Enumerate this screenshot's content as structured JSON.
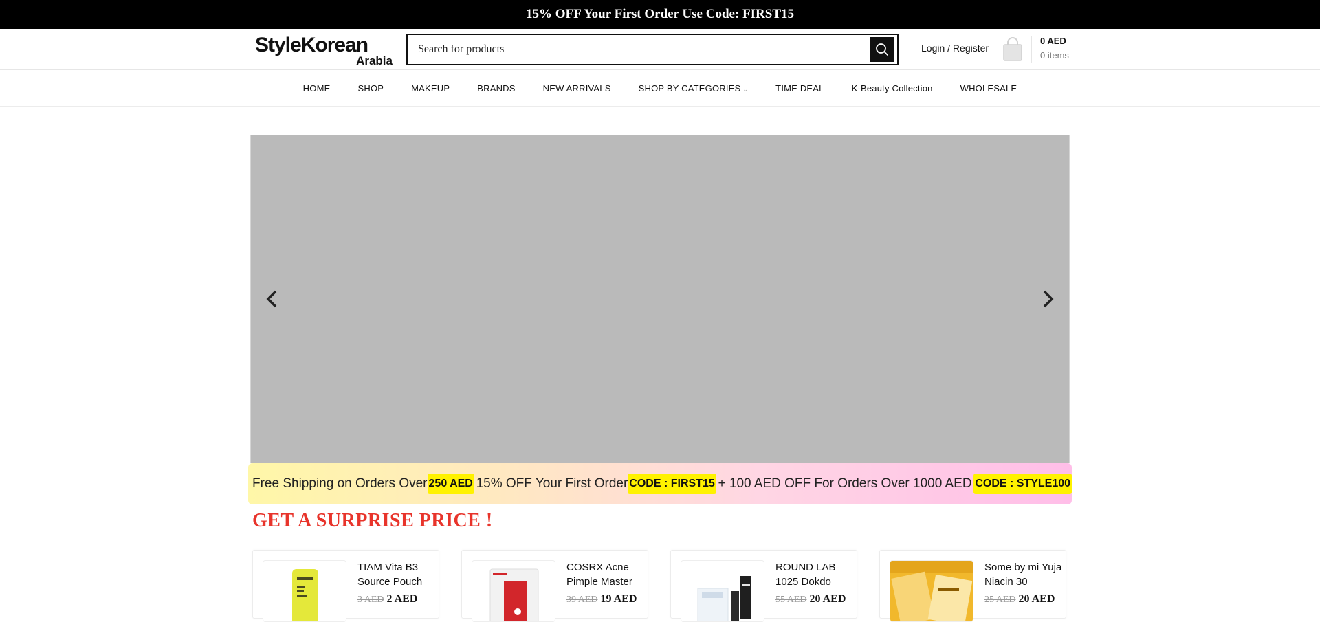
{
  "announcement": "15% OFF Your First Order Use Code: FIRST15",
  "logo": {
    "line1": "StyleKorean",
    "line2": "Arabia"
  },
  "search": {
    "placeholder": "Search for products"
  },
  "account": {
    "login_label": "Login / Register"
  },
  "cart": {
    "total": "0 AED",
    "items": "0 items"
  },
  "nav": {
    "items": [
      {
        "label": "HOME"
      },
      {
        "label": "SHOP"
      },
      {
        "label": "MAKEUP"
      },
      {
        "label": "BRANDS"
      },
      {
        "label": "NEW ARRIVALS"
      },
      {
        "label": "SHOP BY CATEGORIES"
      },
      {
        "label": "TIME DEAL"
      },
      {
        "label": "K-Beauty Collection"
      },
      {
        "label": "WHOLESALE"
      }
    ]
  },
  "promo": {
    "text1": "Free Shipping on Orders Over",
    "code1": "250 AED",
    "text2": "15% OFF Your First Order",
    "code2": "CODE : FIRST15",
    "text3": "+ 100 AED OFF For Orders Over 1000 AED",
    "code3": "CODE : STYLE100"
  },
  "section_title": "GET A SURPRISE PRICE !",
  "products": [
    {
      "title": "TIAM Vita B3 Source Pouch",
      "old_price": "3 AED",
      "price": "2 AED"
    },
    {
      "title": "COSRX Acne Pimple Master",
      "old_price": "39 AED",
      "price": "19 AED"
    },
    {
      "title": "ROUND LAB 1025 Dokdo",
      "old_price": "55 AED",
      "price": "20 AED"
    },
    {
      "title": "Some by mi Yuja Niacin 30",
      "old_price": "25 AED",
      "price": "20 AED"
    }
  ],
  "colors": {
    "accent_red": "#e8342b",
    "highlight_yellow": "#fff200",
    "topbar_bg": "#000000",
    "slider_bg": "#bababa"
  },
  "icons": {
    "search": "search-icon",
    "cart": "shopping-bag-icon",
    "prev": "chevron-left-icon",
    "next": "chevron-right-icon"
  }
}
